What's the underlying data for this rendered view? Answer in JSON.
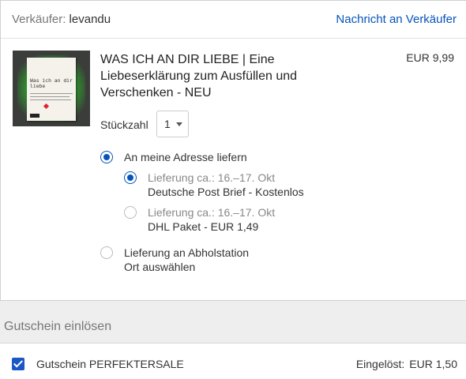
{
  "seller": {
    "label": "Verkäufer:",
    "name": "levandu",
    "contact_link": "Nachricht an Verkäufer"
  },
  "item": {
    "title": "WAS ICH AN DIR LIEBE | Eine Liebeserklärung zum Ausfüllen und Verschenken - NEU",
    "price": "EUR 9,99",
    "thumbnail": {
      "title_line1": "Was ich an dir",
      "title_line2": "liebe",
      "publisher": "riva"
    },
    "quantity_label": "Stückzahl",
    "quantity_value": "1"
  },
  "delivery": {
    "address_option": {
      "label": "An meine Adresse liefern",
      "selected": true,
      "methods": [
        {
          "eta": "Lieferung ca.: 16.–17. Okt",
          "name": "Deutsche Post Brief - Kostenlos",
          "selected": true
        },
        {
          "eta": "Lieferung ca.: 16.–17. Okt",
          "name": "DHL Paket - EUR 1,49",
          "selected": false
        }
      ]
    },
    "pickup_option": {
      "label": "Lieferung an Abholstation",
      "sublabel": "Ort auswählen",
      "selected": false
    }
  },
  "coupon": {
    "heading": "Gutschein einlösen",
    "name": "Gutschein PERFEKTERSALE",
    "status_label": "Eingelöst:",
    "amount": "EUR 1,50",
    "checked": true
  },
  "colors": {
    "link_blue": "#0654ba",
    "checkbox_blue": "#1a56c6",
    "page_bg": "#eeeeee"
  }
}
